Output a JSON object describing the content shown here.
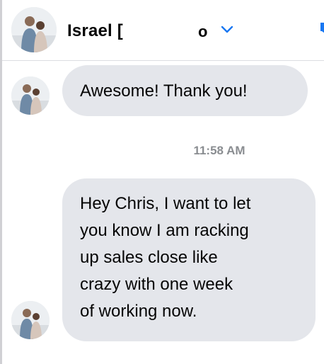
{
  "header": {
    "contact_name": "Israel [",
    "contact_name_tail": "o"
  },
  "messages": [
    {
      "text": "Awesome! Thank you!"
    },
    {
      "lines": [
        "Hey Chris, I want to let",
        "you know I am racking",
        "up sales close like",
        "crazy with one week",
        "of working now."
      ]
    }
  ],
  "timestamp": "11:58 AM",
  "colors": {
    "bubble": "#e4e6eb",
    "text": "#050505",
    "timestamp": "#8a8d91",
    "accent": "#1877f2"
  }
}
